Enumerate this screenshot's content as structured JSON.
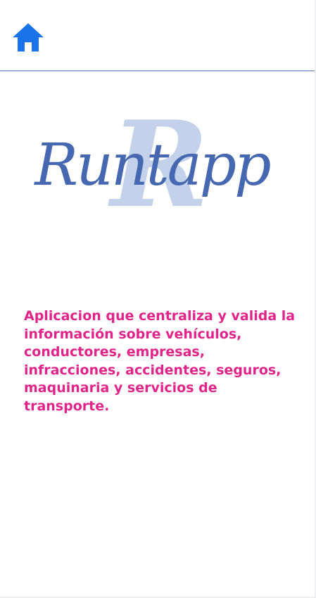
{
  "header": {
    "home_icon": "home-icon",
    "home_color": "#1a73e8",
    "divider_color": "#5b6fc7"
  },
  "logo": {
    "monogram": "R",
    "wordmark": "Runtapp",
    "word_color": "#4668b0",
    "monogram_color": "#c4d1ea"
  },
  "description": {
    "text": "Aplicacion que centraliza y valida la información sobre vehículos, conductores, empresas, infracciones, accidentes, seguros, maquinaria y servicios de transporte.",
    "color": "#e02489"
  }
}
